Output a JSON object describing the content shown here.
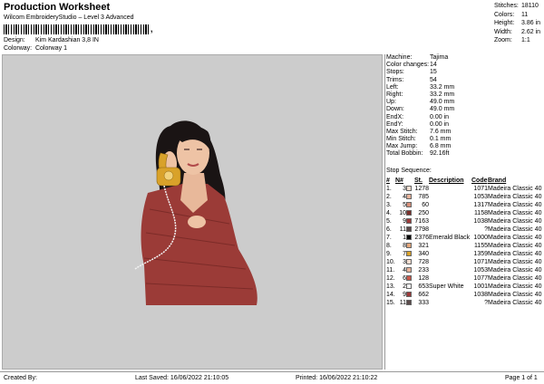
{
  "header": {
    "title": "Production Worksheet",
    "subtitle": "Wilcom EmbroideryStudio – Level 3 Advanced",
    "barcode_mark": ",",
    "design_label": "Design:",
    "design_value": "Kim Kardashian 3,8 IN",
    "colorway_label": "Colorway:",
    "colorway_value": "Colorway 1"
  },
  "stats": [
    {
      "k": "Stitches:",
      "v": "18110"
    },
    {
      "k": "Colors:",
      "v": "11"
    },
    {
      "k": "Height:",
      "v": "3.86 in"
    },
    {
      "k": "Width:",
      "v": "2.62 in"
    },
    {
      "k": "Zoom:",
      "v": "1:1"
    }
  ],
  "info": [
    {
      "k": "Machine:",
      "v": "Tajima"
    },
    {
      "k": "Color changes:",
      "v": "14"
    },
    {
      "k": "Stops:",
      "v": "15"
    },
    {
      "k": "Trims:",
      "v": "54"
    },
    {
      "k": "Left:",
      "v": "33.2 mm"
    },
    {
      "k": "Right:",
      "v": "33.2 mm"
    },
    {
      "k": "Up:",
      "v": "49.0 mm"
    },
    {
      "k": "Down:",
      "v": "49.0 mm"
    },
    {
      "k": "EndX:",
      "v": "0.00 in"
    },
    {
      "k": "EndY:",
      "v": "0.00 in"
    },
    {
      "k": "Max Stitch:",
      "v": "7.6 mm"
    },
    {
      "k": "Min Stitch:",
      "v": "0.1 mm"
    },
    {
      "k": "Max Jump:",
      "v": "6.8 mm"
    },
    {
      "k": "Total Bobbin:",
      "v": "92.16ft"
    }
  ],
  "sequence": {
    "title": "Stop Sequence:",
    "headers": [
      "#",
      "N#",
      "",
      "St.",
      "Description",
      "Code",
      "Brand"
    ],
    "rows": [
      {
        "i": "1.",
        "n": "3",
        "color": "#f3ddd0",
        "st": "1278",
        "desc": "",
        "code": "1071",
        "brand": "Madeira Classic 40"
      },
      {
        "i": "2.",
        "n": "4",
        "color": "#e7b29a",
        "st": "785",
        "desc": "",
        "code": "1053",
        "brand": "Madeira Classic 40"
      },
      {
        "i": "3.",
        "n": "5",
        "color": "#d68f79",
        "st": "60",
        "desc": "",
        "code": "1317",
        "brand": "Madeira Classic 40"
      },
      {
        "i": "4.",
        "n": "10",
        "color": "#7a2f2a",
        "st": "250",
        "desc": "",
        "code": "1158",
        "brand": "Madeira Classic 40"
      },
      {
        "i": "5.",
        "n": "9",
        "color": "#9c3a3a",
        "st": "7163",
        "desc": "",
        "code": "1038",
        "brand": "Madeira Classic 40"
      },
      {
        "i": "6.",
        "n": "11",
        "color": "#5a4a4a",
        "st": "2798",
        "desc": "",
        "code": "?",
        "brand": "Madeira Classic 40"
      },
      {
        "i": "7.",
        "n": "1",
        "color": "#0a0a0a",
        "st": "2376",
        "desc": "Emerald Black",
        "code": "1000",
        "brand": "Madeira Classic 40"
      },
      {
        "i": "8.",
        "n": "8",
        "color": "#e3a57a",
        "st": "321",
        "desc": "",
        "code": "1155",
        "brand": "Madeira Classic 40"
      },
      {
        "i": "9.",
        "n": "7",
        "color": "#d9a22a",
        "st": "340",
        "desc": "",
        "code": "1359",
        "brand": "Madeira Classic 40"
      },
      {
        "i": "10.",
        "n": "3",
        "color": "#f3ddd0",
        "st": "728",
        "desc": "",
        "code": "1071",
        "brand": "Madeira Classic 40"
      },
      {
        "i": "11.",
        "n": "4",
        "color": "#e7b29a",
        "st": "233",
        "desc": "",
        "code": "1053",
        "brand": "Madeira Classic 40"
      },
      {
        "i": "12.",
        "n": "6",
        "color": "#c9584a",
        "st": "128",
        "desc": "",
        "code": "1077",
        "brand": "Madeira Classic 40"
      },
      {
        "i": "13.",
        "n": "2",
        "color": "#f4f4f4",
        "st": "653",
        "desc": "Super White",
        "code": "1001",
        "brand": "Madeira Classic 40"
      },
      {
        "i": "14.",
        "n": "9",
        "color": "#9c3a3a",
        "st": "662",
        "desc": "",
        "code": "1038",
        "brand": "Madeira Classic 40"
      },
      {
        "i": "15.",
        "n": "11",
        "color": "#5a4a4a",
        "st": "333",
        "desc": "",
        "code": "?",
        "brand": "Madeira Classic 40"
      }
    ]
  },
  "footer": {
    "created": "Created By:",
    "saved": "Last Saved: 16/06/2022 21:10:05",
    "printed": "Printed: 16/06/2022 21:10:22",
    "page": "Page 1 of 1"
  }
}
